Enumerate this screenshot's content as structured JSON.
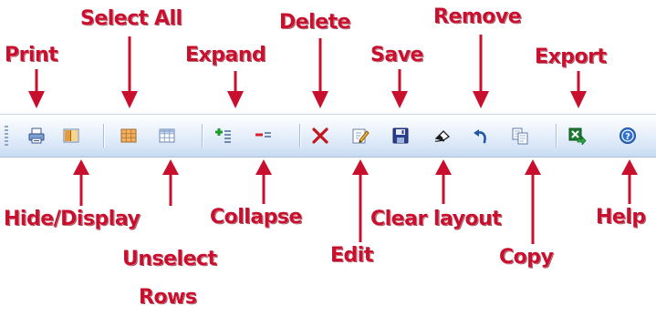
{
  "toolbar": {
    "buttons": [
      {
        "id": "print",
        "label": "Print",
        "icon": "printer-icon"
      },
      {
        "id": "hide-display",
        "label": "Hide/Display",
        "icon": "column-toggle-icon"
      },
      {
        "id": "select-all",
        "label": "Select All",
        "icon": "grid-selected-icon"
      },
      {
        "id": "unselect-rows",
        "label": "Unselect Rows",
        "icon": "grid-icon"
      },
      {
        "id": "expand",
        "label": "Expand",
        "icon": "expand-plus-icon"
      },
      {
        "id": "collapse",
        "label": "Collapse",
        "icon": "collapse-minus-icon"
      },
      {
        "id": "delete",
        "label": "Delete",
        "icon": "delete-x-icon"
      },
      {
        "id": "edit",
        "label": "Edit",
        "icon": "edit-pencil-icon"
      },
      {
        "id": "save",
        "label": "Save",
        "icon": "floppy-disk-icon"
      },
      {
        "id": "clear-layout",
        "label": "Clear layout",
        "icon": "eraser-icon"
      },
      {
        "id": "remove",
        "label": "Remove",
        "icon": "undo-arrow-icon"
      },
      {
        "id": "copy",
        "label": "Copy",
        "icon": "copy-icon"
      },
      {
        "id": "export",
        "label": "Export",
        "icon": "excel-export-icon"
      },
      {
        "id": "help",
        "label": "Help",
        "icon": "help-question-icon"
      }
    ]
  },
  "annotations": {
    "print": "Print",
    "select_all": "Select All",
    "expand": "Expand",
    "delete": "Delete",
    "save": "Save",
    "remove": "Remove",
    "export": "Export",
    "hide_display": "Hide/Display",
    "unselect_line1": "Unselect",
    "unselect_line2": "Rows",
    "collapse": "Collapse",
    "edit": "Edit",
    "clear_layout": "Clear layout",
    "copy": "Copy",
    "help": "Help"
  },
  "colors": {
    "annotation_text": "#c8102e",
    "arrow": "#c8102e",
    "toolbar_top": "#eef4fc",
    "toolbar_bottom": "#c7daf2"
  }
}
